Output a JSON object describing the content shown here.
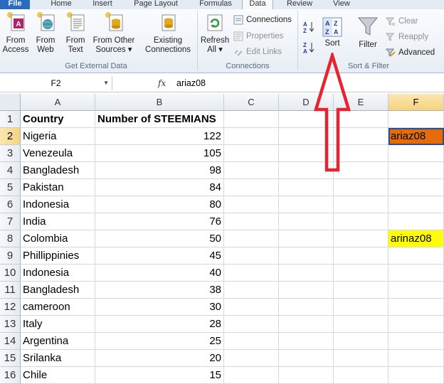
{
  "tabs": [
    "File",
    "Home",
    "Insert",
    "Page Layout",
    "Formulas",
    "Data",
    "Review",
    "View"
  ],
  "active_tab": "Data",
  "ribbon": {
    "get_external": {
      "from_access": [
        "From",
        "Access"
      ],
      "from_web": [
        "From",
        "Web"
      ],
      "from_text": [
        "From",
        "Text"
      ],
      "from_other": [
        "From Other",
        "Sources ▾"
      ],
      "existing": [
        "Existing",
        "Connections"
      ],
      "label": "Get External Data"
    },
    "connections": {
      "refresh": [
        "Refresh",
        "All ▾"
      ],
      "connections": "Connections",
      "properties": "Properties",
      "edit_links": "Edit Links",
      "label": "Connections"
    },
    "sort_filter": {
      "sort": "Sort",
      "filter": "Filter",
      "clear": "Clear",
      "reapply": "Reapply",
      "advanced": "Advanced",
      "label": "Sort & Filter"
    }
  },
  "formula_bar": {
    "name_box": "F2",
    "fx": "fx",
    "content": "ariaz08"
  },
  "columns": [
    "A",
    "B",
    "C",
    "D",
    "E",
    "F"
  ],
  "selected_column": "F",
  "selected_row": 2,
  "header_row": {
    "country": "Country",
    "count": "Number of STEEMIANS"
  },
  "rows": [
    {
      "n": 1
    },
    {
      "n": 2,
      "country": "Nigeria",
      "count": "122",
      "f": "ariaz08"
    },
    {
      "n": 3,
      "country": "Venezeula",
      "count": "105"
    },
    {
      "n": 4,
      "country": "Bangladesh",
      "count": "98"
    },
    {
      "n": 5,
      "country": "Pakistan",
      "count": "84"
    },
    {
      "n": 6,
      "country": "Indonesia",
      "count": "80"
    },
    {
      "n": 7,
      "country": "India",
      "count": "76"
    },
    {
      "n": 8,
      "country": "Colombia",
      "count": "50",
      "f": "arinaz08"
    },
    {
      "n": 9,
      "country": "Phillippinies",
      "count": "45"
    },
    {
      "n": 10,
      "country": "Indonesia",
      "count": "40"
    },
    {
      "n": 11,
      "country": "Bangladesh",
      "count": "38"
    },
    {
      "n": 12,
      "country": "cameroon",
      "count": "30"
    },
    {
      "n": 13,
      "country": "Italy",
      "count": "28"
    },
    {
      "n": 14,
      "country": "Argentina",
      "count": "25"
    },
    {
      "n": 15,
      "country": "Srilanka",
      "count": "20"
    },
    {
      "n": 16,
      "country": "Chile",
      "count": "15"
    }
  ],
  "colors": {
    "f2_fill": "#e46c0a",
    "f8_fill": "#ffff00",
    "arrow": "#e8232f",
    "selection": "#2b4d8c",
    "file_tab": "#2a6bbf"
  }
}
